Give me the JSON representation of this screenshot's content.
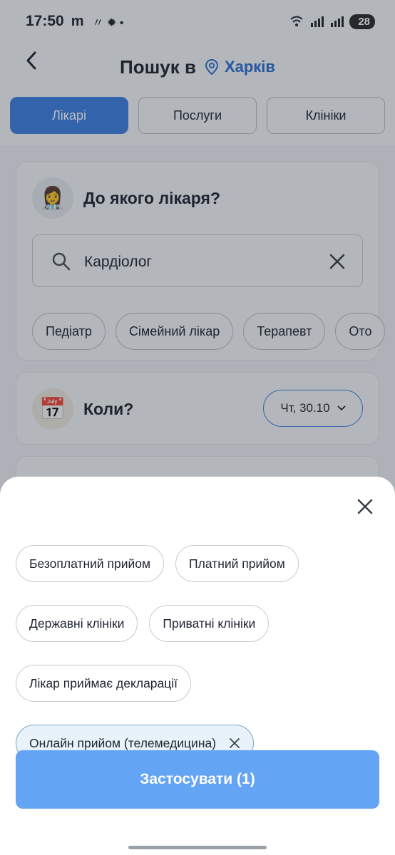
{
  "status_bar": {
    "time": "17:50",
    "extra": "m",
    "battery": "28"
  },
  "header": {
    "title": "Пошук в",
    "city": "Харків"
  },
  "tabs": [
    {
      "label": "Лікарі",
      "active": true
    },
    {
      "label": "Послуги",
      "active": false
    },
    {
      "label": "Клініки",
      "active": false
    }
  ],
  "doctor_card": {
    "avatar_icon": "doctor-avatar-icon",
    "title": "До якого лікаря?",
    "search_value": "Кардіолог",
    "suggestions": [
      "Педіатр",
      "Сімейний лікар",
      "Терапевт",
      "Ото"
    ]
  },
  "when_card": {
    "avatar_icon": "calendar-icon",
    "title": "Коли?",
    "date": "Чт, 30.10"
  },
  "filter_sheet": {
    "filters": [
      {
        "label": "Безоплатний прийом",
        "selected": false
      },
      {
        "label": "Платний прийом",
        "selected": false
      },
      {
        "label": "Державні клініки",
        "selected": false
      },
      {
        "label": "Приватні клініки",
        "selected": false
      },
      {
        "label": "Лікар приймає декларації",
        "selected": false
      },
      {
        "label": "Онлайн прийом (телемедицина)",
        "selected": true
      }
    ],
    "apply_label": "Застосувати (1)"
  },
  "colors": {
    "accent": "#3d7fe0",
    "apply": "#63a4f4",
    "city": "#2a6fd1"
  }
}
